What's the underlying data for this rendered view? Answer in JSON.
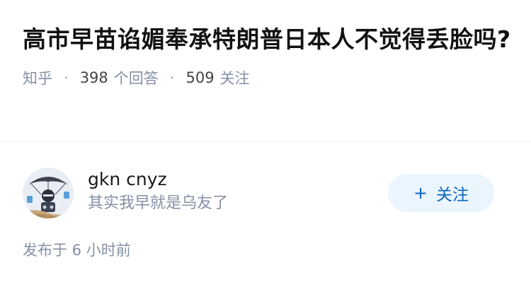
{
  "question": {
    "title": "高市早苗谄媚奉承特朗普日本人不觉得丢脸吗?",
    "source": "知乎",
    "answer_count": "398",
    "answer_label": "个回答",
    "follower_count": "509",
    "follower_label": "关注"
  },
  "author": {
    "name": "gkn cnyz",
    "bio": "其实我早就是乌友了",
    "follow_icon": "plus",
    "follow_label": "关注"
  },
  "answer": {
    "publish_time": "发布于 6 小时前"
  },
  "colors": {
    "meta_gray": "#8590a6",
    "follow_bg": "#ebf5fd",
    "follow_text": "#0a66c2"
  }
}
